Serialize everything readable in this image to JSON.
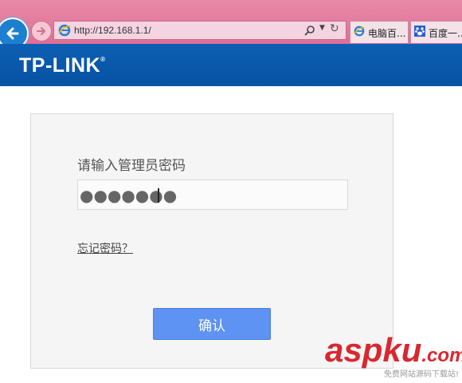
{
  "browser": {
    "address_url": "http://192.168.1.1/",
    "tabs": [
      {
        "label": "电脑百..."
      },
      {
        "label": "百度一..."
      }
    ]
  },
  "router": {
    "brand": "TP-LINK",
    "login": {
      "title": "请输入管理员密码",
      "password_mask": "●●●●●●●",
      "forgot_link": "忘记密码？",
      "confirm_label": "确认"
    }
  },
  "watermark": {
    "main": "aspku",
    "domain": ".com",
    "tagline": "免费网站源码下载站!"
  },
  "colors": {
    "chrome_pink": "#e06e96",
    "brand_blue": "#0652a3",
    "confirm_blue": "#5e92f3",
    "watermark_red": "#d8282f"
  }
}
